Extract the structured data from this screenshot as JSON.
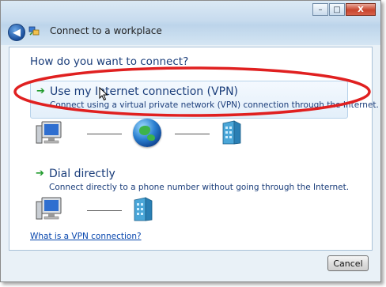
{
  "window": {
    "title": "Connect to a workplace",
    "controls": {
      "minimize": "–",
      "maximize": "□",
      "close": "X"
    }
  },
  "content": {
    "heading": "How do you want to connect?",
    "options": [
      {
        "title": "Use my Internet connection (VPN)",
        "description": "Connect using a virtual private network (VPN) connection through the Internet."
      },
      {
        "title": "Dial directly",
        "description": "Connect directly to a phone number without going through the Internet."
      }
    ],
    "help_link": "What is a VPN connection?"
  },
  "footer": {
    "cancel_label": "Cancel"
  },
  "icons": {
    "back": "back-arrow-icon",
    "wizard": "network-wizard-icon",
    "option_arrow": "green-arrow-icon",
    "computer": "computer-icon",
    "internet": "globe-icon",
    "workplace": "office-building-icon"
  },
  "colors": {
    "link": "#0645ad",
    "heading_text": "#1a3d7a",
    "highlight_annotation": "#e02020",
    "option_arrow": "#1e9a2a"
  }
}
